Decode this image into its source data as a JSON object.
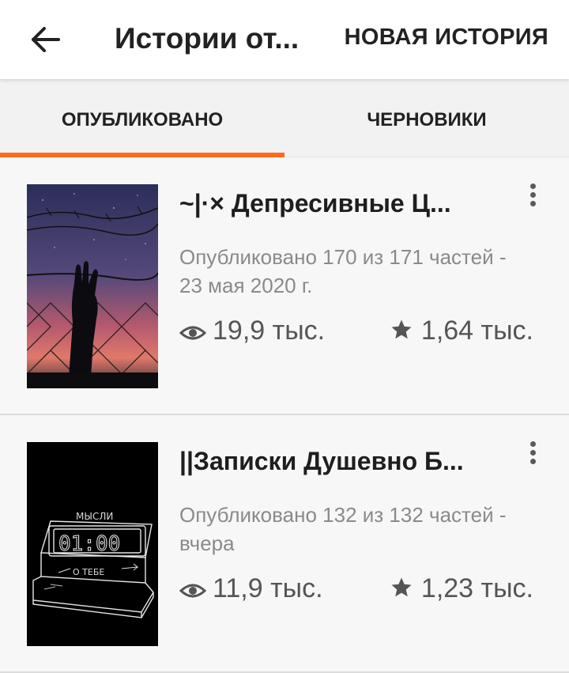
{
  "header": {
    "title": "Истории от...",
    "new_story_label": "НОВАЯ ИСТОРИЯ",
    "back_icon": "arrow-left-icon"
  },
  "tabs": [
    {
      "label": "ОПУБЛИКОВАНО",
      "active": true
    },
    {
      "label": "ЧЕРНОВИКИ",
      "active": false
    }
  ],
  "colors": {
    "accent": "#ff6a1f",
    "text": "#222222",
    "muted": "#8a8a8a"
  },
  "stories": [
    {
      "title": "~|·× Депресивные Ц...",
      "status": "Опубликовано 170 из 171 частей - 23 мая 2020 г.",
      "views": "19,9 тыс.",
      "votes": "1,64 тыс.",
      "cover": "barbed-wire-hand-cover"
    },
    {
      "title": "||Записки Душевно Б...",
      "status": "Опубликовано 132 из 132 частей - вчера",
      "views": "11,9 тыс.",
      "votes": "1,23 тыс.",
      "cover": "alarm-clock-sketch-cover",
      "cover_text": {
        "top": "МЫСЛИ",
        "time": "01:00",
        "bottom": "О ТЕБЕ"
      }
    }
  ]
}
